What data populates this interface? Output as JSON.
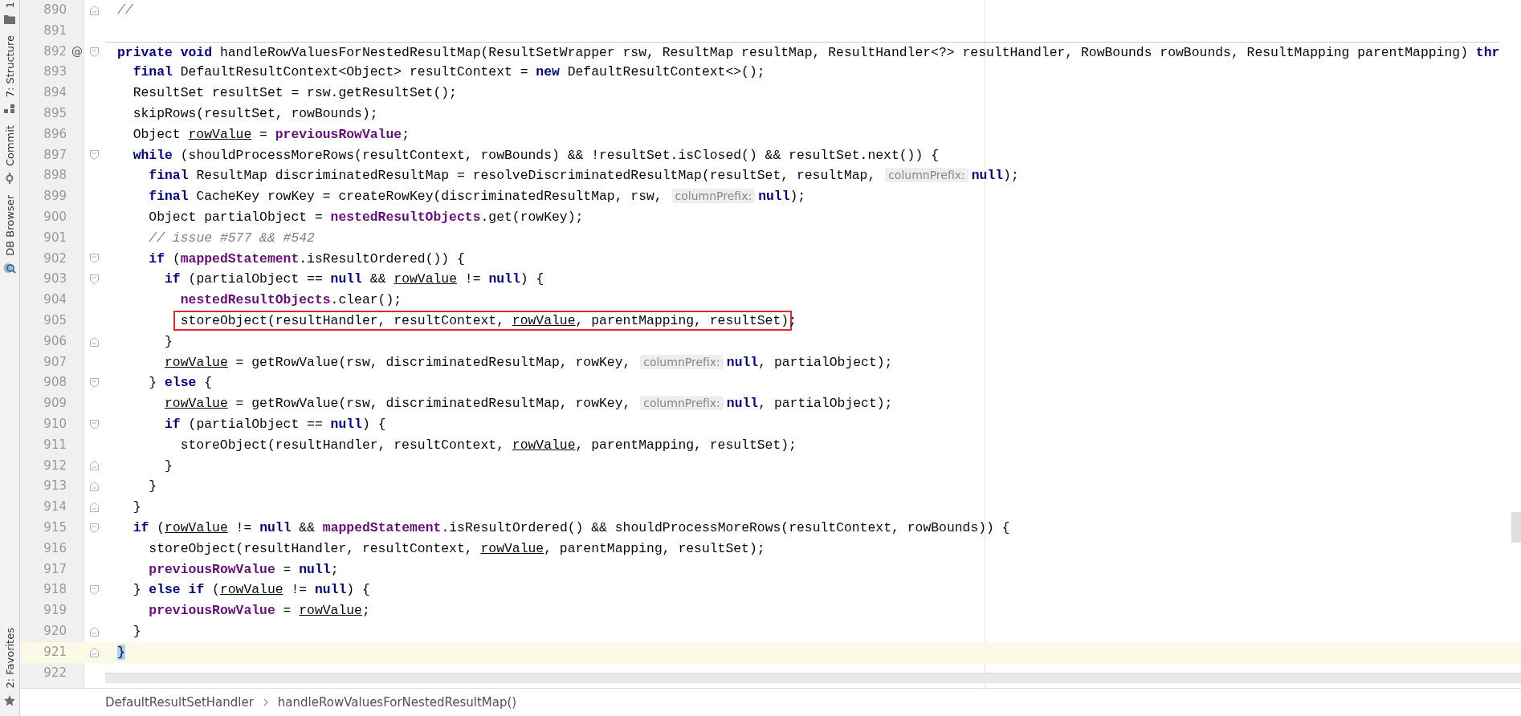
{
  "tool_strip": {
    "top": [
      {
        "label": "1",
        "kind": "folder"
      },
      {
        "label": "7: Structure",
        "kind": "structure"
      },
      {
        "label": "Commit",
        "kind": "commit"
      },
      {
        "label": "DB Browser",
        "kind": "database"
      }
    ],
    "bottom": [
      {
        "label": "2: Favorites",
        "kind": "star"
      }
    ]
  },
  "editor": {
    "lines": [
      {
        "number": "890",
        "fold": {
          "kind": "end"
        },
        "current": false,
        "separator": false,
        "segments": [
          {
            "kind": "comment",
            "text": "//"
          }
        ]
      },
      {
        "number": "891",
        "current": false,
        "separator": false
      },
      {
        "number": "892",
        "gutter_mark": "@",
        "fold": {
          "kind": "start"
        },
        "current": false,
        "separator": true,
        "segments": [
          {
            "kind": "keyword",
            "text": "private void"
          },
          {
            "kind": "plain",
            "text": " handleRowValuesForNestedResultMap(ResultSetWrapper rsw, ResultMap resultMap, ResultHandler<?> resultHandler, RowBounds rowBounds, ResultMapping parentMapping) "
          },
          {
            "kind": "keyword",
            "text": "thr"
          }
        ]
      },
      {
        "number": "893",
        "current": false,
        "separator": false,
        "segments": [
          {
            "kind": "keyword",
            "text": "  final"
          },
          {
            "kind": "plain",
            "text": " DefaultResultContext<Object> resultContext = "
          },
          {
            "kind": "keyword",
            "text": "new"
          },
          {
            "kind": "plain",
            "text": " DefaultResultContext<>();"
          }
        ]
      },
      {
        "number": "894",
        "current": false,
        "separator": false,
        "segments": [
          {
            "kind": "plain",
            "text": "  ResultSet resultSet = rsw.getResultSet();"
          }
        ]
      },
      {
        "number": "895",
        "current": false,
        "separator": false,
        "segments": [
          {
            "kind": "plain",
            "text": "  skipRows(resultSet, rowBounds);"
          }
        ]
      },
      {
        "number": "896",
        "current": false,
        "separator": false,
        "segments": [
          {
            "kind": "plain",
            "text": "  Object "
          },
          {
            "kind": "variable",
            "text": "rowValue"
          },
          {
            "kind": "plain",
            "text": " = "
          },
          {
            "kind": "field",
            "text": "previousRowValue"
          },
          {
            "kind": "plain",
            "text": ";"
          }
        ]
      },
      {
        "number": "897",
        "fold": {
          "kind": "start"
        },
        "current": false,
        "separator": false,
        "segments": [
          {
            "kind": "keyword",
            "text": "  while"
          },
          {
            "kind": "plain",
            "text": " (shouldProcessMoreRows(resultContext, rowBounds) && !resultSet.isClosed() && resultSet.next()) {"
          }
        ]
      },
      {
        "number": "898",
        "current": false,
        "separator": false,
        "segments": [
          {
            "kind": "keyword",
            "text": "    final"
          },
          {
            "kind": "plain",
            "text": " ResultMap discriminatedResultMap = resolveDiscriminatedResultMap(resultSet, resultMap, "
          },
          {
            "kind": "hint",
            "text": "columnPrefix:"
          },
          {
            "kind": "keyword",
            "text": "null"
          },
          {
            "kind": "plain",
            "text": ");"
          }
        ]
      },
      {
        "number": "899",
        "current": false,
        "separator": false,
        "segments": [
          {
            "kind": "keyword",
            "text": "    final"
          },
          {
            "kind": "plain",
            "text": " CacheKey rowKey = createRowKey(discriminatedResultMap, rsw, "
          },
          {
            "kind": "hint",
            "text": "columnPrefix:"
          },
          {
            "kind": "keyword",
            "text": "null"
          },
          {
            "kind": "plain",
            "text": ");"
          }
        ]
      },
      {
        "number": "900",
        "current": false,
        "separator": false,
        "segments": [
          {
            "kind": "plain",
            "text": "    Object partialObject = "
          },
          {
            "kind": "field",
            "text": "nestedResultObjects"
          },
          {
            "kind": "plain",
            "text": ".get(rowKey);"
          }
        ]
      },
      {
        "number": "901",
        "current": false,
        "separator": false,
        "segments": [
          {
            "kind": "comment",
            "text": "    // issue #577 && #542"
          }
        ]
      },
      {
        "number": "902",
        "fold": {
          "kind": "start"
        },
        "current": false,
        "separator": false,
        "segments": [
          {
            "kind": "keyword",
            "text": "    if"
          },
          {
            "kind": "plain",
            "text": " ("
          },
          {
            "kind": "field",
            "text": "mappedStatement"
          },
          {
            "kind": "plain",
            "text": ".isResultOrdered()) {"
          }
        ]
      },
      {
        "number": "903",
        "fold": {
          "kind": "start"
        },
        "current": false,
        "separator": false,
        "segments": [
          {
            "kind": "keyword",
            "text": "      if"
          },
          {
            "kind": "plain",
            "text": " (partialObject == "
          },
          {
            "kind": "keyword",
            "text": "null"
          },
          {
            "kind": "plain",
            "text": " && "
          },
          {
            "kind": "variable",
            "text": "rowValue"
          },
          {
            "kind": "plain",
            "text": " != "
          },
          {
            "kind": "keyword",
            "text": "null"
          },
          {
            "kind": "plain",
            "text": ") {"
          }
        ]
      },
      {
        "number": "904",
        "current": false,
        "separator": false,
        "segments": [
          {
            "kind": "field",
            "text": "        nestedResultObjects"
          },
          {
            "kind": "plain",
            "text": ".clear();"
          }
        ]
      },
      {
        "number": "905",
        "current": false,
        "separator": false,
        "segments": [
          {
            "kind": "box",
            "segments": [
              {
                "kind": "plain",
                "text": "        storeObject(resultHandler, resultContext, "
              },
              {
                "kind": "variable",
                "text": "rowValue"
              },
              {
                "kind": "plain",
                "text": ", parentMapping, resultSet)"
              }
            ]
          },
          {
            "kind": "plain",
            "text": ";"
          }
        ]
      },
      {
        "number": "906",
        "fold": {
          "kind": "end"
        },
        "current": false,
        "separator": false,
        "segments": [
          {
            "kind": "plain",
            "text": "      }"
          }
        ]
      },
      {
        "number": "907",
        "current": false,
        "separator": false,
        "segments": [
          {
            "kind": "variable",
            "text": "      rowValue"
          },
          {
            "kind": "plain",
            "text": " = getRowValue(rsw, discriminatedResultMap, rowKey, "
          },
          {
            "kind": "hint",
            "text": "columnPrefix:"
          },
          {
            "kind": "keyword",
            "text": "null"
          },
          {
            "kind": "plain",
            "text": ", partialObject);"
          }
        ]
      },
      {
        "number": "908",
        "fold": {
          "kind": "start"
        },
        "current": false,
        "separator": false,
        "segments": [
          {
            "kind": "plain",
            "text": "    } "
          },
          {
            "kind": "keyword",
            "text": "else"
          },
          {
            "kind": "plain",
            "text": " {"
          }
        ]
      },
      {
        "number": "909",
        "current": false,
        "separator": false,
        "segments": [
          {
            "kind": "variable",
            "text": "      rowValue"
          },
          {
            "kind": "plain",
            "text": " = getRowValue(rsw, discriminatedResultMap, rowKey, "
          },
          {
            "kind": "hint",
            "text": "columnPrefix:"
          },
          {
            "kind": "keyword",
            "text": "null"
          },
          {
            "kind": "plain",
            "text": ", partialObject);"
          }
        ]
      },
      {
        "number": "910",
        "fold": {
          "kind": "start"
        },
        "current": false,
        "separator": false,
        "segments": [
          {
            "kind": "keyword",
            "text": "      if"
          },
          {
            "kind": "plain",
            "text": " (partialObject == "
          },
          {
            "kind": "keyword",
            "text": "null"
          },
          {
            "kind": "plain",
            "text": ") {"
          }
        ]
      },
      {
        "number": "911",
        "current": false,
        "separator": false,
        "segments": [
          {
            "kind": "plain",
            "text": "        storeObject(resultHandler, resultContext, "
          },
          {
            "kind": "variable",
            "text": "rowValue"
          },
          {
            "kind": "plain",
            "text": ", parentMapping, resultSet);"
          }
        ]
      },
      {
        "number": "912",
        "fold": {
          "kind": "end"
        },
        "current": false,
        "separator": false,
        "segments": [
          {
            "kind": "plain",
            "text": "      }"
          }
        ]
      },
      {
        "number": "913",
        "fold": {
          "kind": "end"
        },
        "current": false,
        "separator": false,
        "segments": [
          {
            "kind": "plain",
            "text": "    }"
          }
        ]
      },
      {
        "number": "914",
        "fold": {
          "kind": "end"
        },
        "current": false,
        "separator": false,
        "segments": [
          {
            "kind": "plain",
            "text": "  }"
          }
        ]
      },
      {
        "number": "915",
        "fold": {
          "kind": "start"
        },
        "current": false,
        "separator": false,
        "segments": [
          {
            "kind": "keyword",
            "text": "  if"
          },
          {
            "kind": "plain",
            "text": " ("
          },
          {
            "kind": "variable",
            "text": "rowValue"
          },
          {
            "kind": "plain",
            "text": " != "
          },
          {
            "kind": "keyword",
            "text": "null"
          },
          {
            "kind": "plain",
            "text": " && "
          },
          {
            "kind": "field",
            "text": "mappedStatement"
          },
          {
            "kind": "plain",
            "text": ".isResultOrdered() && shouldProcessMoreRows(resultContext, rowBounds)) {"
          }
        ]
      },
      {
        "number": "916",
        "current": false,
        "separator": false,
        "segments": [
          {
            "kind": "plain",
            "text": "    storeObject(resultHandler, resultContext, "
          },
          {
            "kind": "variable",
            "text": "rowValue"
          },
          {
            "kind": "plain",
            "text": ", parentMapping, resultSet);"
          }
        ]
      },
      {
        "number": "917",
        "current": false,
        "separator": false,
        "segments": [
          {
            "kind": "field",
            "text": "    previousRowValue"
          },
          {
            "kind": "plain",
            "text": " = "
          },
          {
            "kind": "keyword",
            "text": "null"
          },
          {
            "kind": "plain",
            "text": ";"
          }
        ]
      },
      {
        "number": "918",
        "fold": {
          "kind": "start"
        },
        "current": false,
        "separator": false,
        "segments": [
          {
            "kind": "plain",
            "text": "  } "
          },
          {
            "kind": "keyword",
            "text": "else if"
          },
          {
            "kind": "plain",
            "text": " ("
          },
          {
            "kind": "variable",
            "text": "rowValue"
          },
          {
            "kind": "plain",
            "text": " != "
          },
          {
            "kind": "keyword",
            "text": "null"
          },
          {
            "kind": "plain",
            "text": ") {"
          }
        ]
      },
      {
        "number": "919",
        "current": false,
        "separator": false,
        "segments": [
          {
            "kind": "field",
            "text": "    previousRowValue"
          },
          {
            "kind": "plain",
            "text": " = "
          },
          {
            "kind": "variable",
            "text": "rowValue"
          },
          {
            "kind": "plain",
            "text": ";"
          }
        ]
      },
      {
        "number": "920",
        "fold": {
          "kind": "end"
        },
        "current": false,
        "separator": false,
        "segments": [
          {
            "kind": "plain",
            "text": "  }"
          }
        ]
      },
      {
        "number": "921",
        "fold": {
          "kind": "end"
        },
        "current": true,
        "separator": false,
        "segments": [
          {
            "kind": "brace",
            "text": "}"
          }
        ]
      },
      {
        "number": "922",
        "current": false,
        "separator": false
      }
    ]
  },
  "breadcrumbs": [
    {
      "label": "DefaultResultSetHandler"
    },
    {
      "label": "handleRowValuesForNestedResultMap()"
    }
  ]
}
